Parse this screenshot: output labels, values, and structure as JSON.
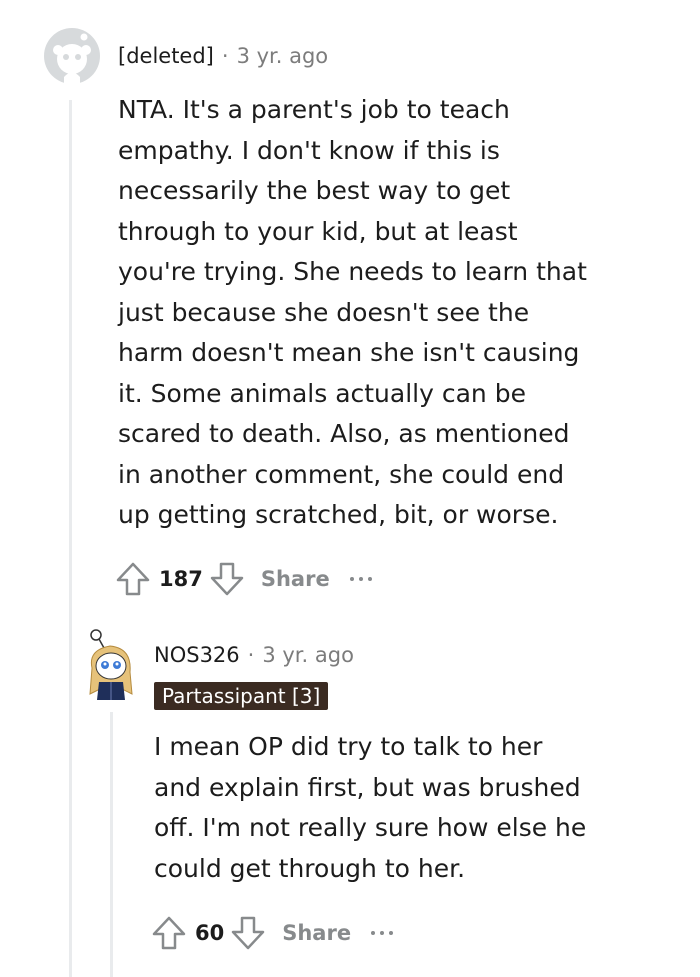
{
  "comments": [
    {
      "username": "[deleted]",
      "separator": "·",
      "time": "3 yr. ago",
      "avatar_icon": "deleted-user-avatar",
      "lines": [
        "NTA. It's a parent's job to teach",
        "empathy. I don't know if this is",
        "necessarily the best way to get",
        "through to your kid, but at least",
        "you're trying. She needs to learn that",
        "just because she doesn't see the",
        "harm doesn't mean she isn't causing",
        "it. Some animals actually can be",
        "scared to death. Also, as mentioned",
        "in another comment, she could end",
        "up getting scratched, bit, or worse."
      ],
      "score": "187",
      "share_label": "Share"
    },
    {
      "username": "NOS326",
      "separator": "·",
      "time": "3 yr. ago",
      "avatar_icon": "snoo-avatar",
      "flair": "Partassipant [3]",
      "flair_color": "#3b2b22",
      "lines": [
        "I mean OP did try to talk to her",
        "and explain first, but was brushed",
        "off. I'm not really sure how else he",
        "could get through to her."
      ],
      "score": "60",
      "share_label": "Share"
    }
  ]
}
